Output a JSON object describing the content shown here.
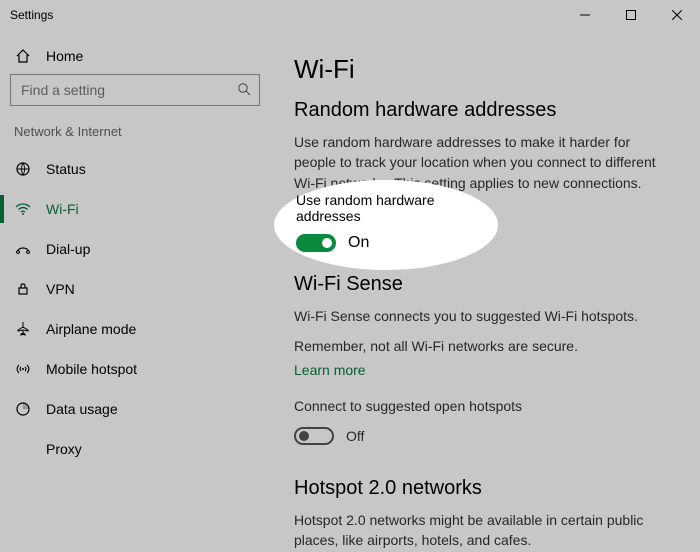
{
  "window": {
    "title": "Settings"
  },
  "sidebar": {
    "home": "Home",
    "search_placeholder": "Find a setting",
    "category": "Network & Internet",
    "items": [
      {
        "label": "Status"
      },
      {
        "label": "Wi-Fi"
      },
      {
        "label": "Dial-up"
      },
      {
        "label": "VPN"
      },
      {
        "label": "Airplane mode"
      },
      {
        "label": "Mobile hotspot"
      },
      {
        "label": "Data usage"
      },
      {
        "label": "Proxy"
      }
    ]
  },
  "main": {
    "page_title": "Wi-Fi",
    "random_hw": {
      "heading": "Random hardware addresses",
      "body": "Use random hardware addresses to make it harder for people to track your location when you connect to different Wi-Fi networks. This setting applies to new connections.",
      "toggle_label": "Use random hardware addresses",
      "toggle_state": "On"
    },
    "wifi_sense": {
      "heading": "Wi-Fi Sense",
      "body1": "Wi-Fi Sense connects you to suggested Wi-Fi hotspots.",
      "body2": "Remember, not all Wi-Fi networks are secure.",
      "learn_more": "Learn more",
      "connect_label": "Connect to suggested open hotspots",
      "connect_state": "Off"
    },
    "hotspot2": {
      "heading": "Hotspot 2.0 networks",
      "body": "Hotspot 2.0 networks might be available in certain public places, like airports, hotels, and cafes."
    }
  }
}
